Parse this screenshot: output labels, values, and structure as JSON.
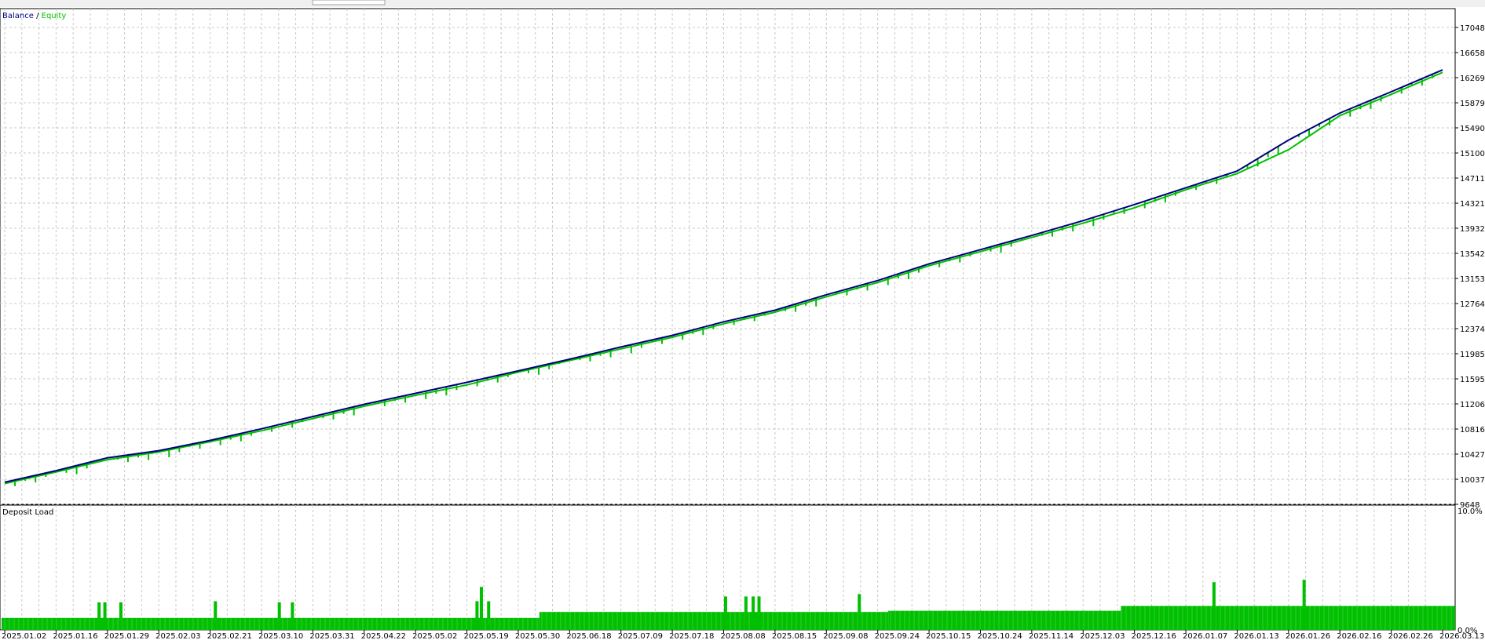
{
  "balance_chart": {
    "legend": {
      "balance": "Balance",
      "separator": " / ",
      "equity": "Equity"
    },
    "colors": {
      "balance": "#00007f",
      "equity": "#00c000",
      "grid": "#c8c8c8",
      "frame": "#000000"
    }
  },
  "deposit_panel": {
    "title": "Deposit Load",
    "color": "#00c000"
  },
  "chart_data": [
    {
      "type": "line",
      "title": "",
      "xlabel": "",
      "ylabel": "",
      "ylim": [
        9648,
        17048
      ],
      "y_ticks": [
        "17048",
        "16658",
        "16269",
        "15879",
        "15490",
        "15100",
        "14711",
        "14321",
        "13932",
        "13542",
        "13153",
        "12764",
        "12374",
        "11985",
        "11595",
        "11206",
        "10816",
        "10427",
        "10037",
        "9648"
      ],
      "x": [
        "2025.01.02",
        "2025.01.16",
        "2025.01.29",
        "2025.02.03",
        "2025.02.21",
        "2025.03.10",
        "2025.03.31",
        "2025.04.22",
        "2025.05.02",
        "2025.05.19",
        "2025.05.30",
        "2025.06.18",
        "2025.07.09",
        "2025.07.18",
        "2025.08.08",
        "2025.08.15",
        "2025.09.08",
        "2025.09.24",
        "2025.10.15",
        "2025.10.24",
        "2025.11.14",
        "2025.12.03",
        "2025.12.16",
        "2026.01.07",
        "2026.01.13",
        "2026.01.26",
        "2026.02.16",
        "2026.02.26",
        "2026.03.13"
      ],
      "series": [
        {
          "name": "Balance",
          "values": [
            9990,
            10170,
            10370,
            10480,
            10640,
            10820,
            11010,
            11200,
            11370,
            11540,
            11720,
            11900,
            12090,
            12270,
            12480,
            12660,
            12900,
            13120,
            13380,
            13600,
            13820,
            14050,
            14300,
            14560,
            14820,
            15300,
            15720,
            16050,
            16390
          ]
        },
        {
          "name": "Equity",
          "values": [
            9970,
            10150,
            10340,
            10460,
            10620,
            10790,
            10980,
            11170,
            11340,
            11500,
            11700,
            11880,
            12060,
            12240,
            12450,
            12630,
            12870,
            13090,
            13350,
            13570,
            13790,
            14010,
            14250,
            14530,
            14780,
            15150,
            15680,
            16010,
            16350
          ]
        }
      ],
      "grid": true,
      "legend_position": "top-left"
    },
    {
      "type": "bar",
      "title": "Deposit Load",
      "ylim": [
        0,
        10
      ],
      "y_ticks": [
        "10.0%",
        "0.0%"
      ],
      "baseline_levels": [
        {
          "from": 0,
          "to": 0.37,
          "value": 1.0
        },
        {
          "from": 0.37,
          "to": 0.61,
          "value": 1.5
        },
        {
          "from": 0.61,
          "to": 0.77,
          "value": 1.6
        },
        {
          "from": 0.77,
          "to": 1.0,
          "value": 2.0
        }
      ],
      "spikes": [
        {
          "at": 0.066,
          "value": 2.3
        },
        {
          "at": 0.07,
          "value": 2.3
        },
        {
          "at": 0.081,
          "value": 2.3
        },
        {
          "at": 0.146,
          "value": 2.4
        },
        {
          "at": 0.19,
          "value": 2.3
        },
        {
          "at": 0.199,
          "value": 2.3
        },
        {
          "at": 0.326,
          "value": 2.4
        },
        {
          "at": 0.329,
          "value": 3.6
        },
        {
          "at": 0.334,
          "value": 2.4
        },
        {
          "at": 0.497,
          "value": 2.8
        },
        {
          "at": 0.511,
          "value": 2.8
        },
        {
          "at": 0.516,
          "value": 2.8
        },
        {
          "at": 0.52,
          "value": 2.8
        },
        {
          "at": 0.589,
          "value": 3.0
        },
        {
          "at": 0.833,
          "value": 4.0
        },
        {
          "at": 0.895,
          "value": 4.2
        }
      ]
    }
  ]
}
